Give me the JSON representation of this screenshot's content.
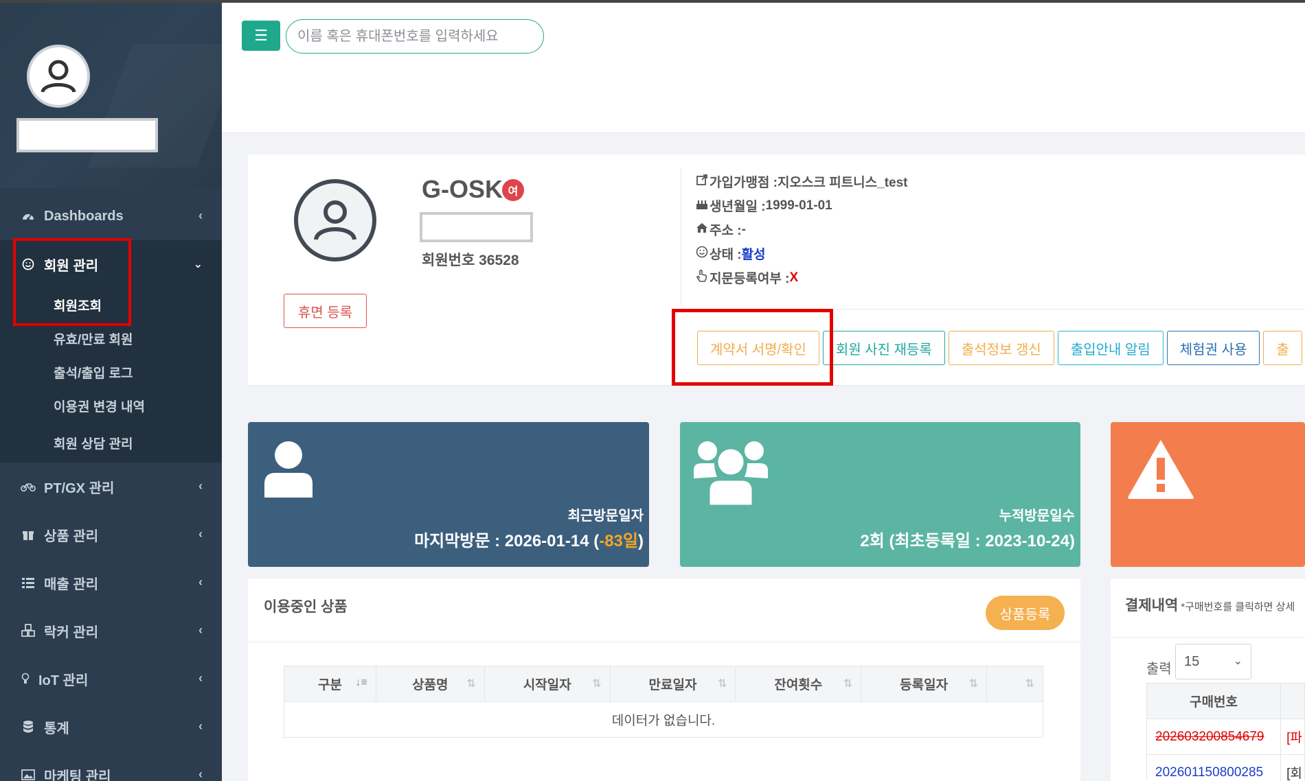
{
  "search": {
    "placeholder": "이름 혹은 휴대폰번호를 입력하세요"
  },
  "sidebar": {
    "nav": [
      {
        "label": "Dashboards",
        "icon": "dashboard-icon"
      },
      {
        "label": "회원 관리",
        "icon": "smile-icon",
        "expanded": true
      },
      {
        "label": "PT/GX 관리",
        "icon": "bicycle-icon"
      },
      {
        "label": "상품 관리",
        "icon": "gift-icon"
      },
      {
        "label": "매출 관리",
        "icon": "list-icon"
      },
      {
        "label": "락커 관리",
        "icon": "cubes-icon"
      },
      {
        "label": "IoT 관리",
        "icon": "lightbulb-icon"
      },
      {
        "label": "통계",
        "icon": "database-icon"
      },
      {
        "label": "마케팅 관리",
        "icon": "image-icon"
      }
    ],
    "sub_items": [
      "회원조회",
      "유효/만료 회원",
      "출석/출입 로그",
      "이용권 변경 내역",
      "회원 상담 관리"
    ]
  },
  "member": {
    "name": "G-OSK",
    "gender": "여",
    "number": "회원번호 36528",
    "dormant_label": "휴면 등록",
    "branch_label": "가입가맹점 : ",
    "branch": "지오스크 피트니스_test",
    "birth_label": "생년월일 : ",
    "birth": "1999-01-01",
    "address_label": "주소 : ",
    "address": "-",
    "status_label": "상태 : ",
    "status": "활성",
    "fingerprint_label": "지문등록여부 : ",
    "fingerprint": "X"
  },
  "actions": [
    "계약서 서명/확인",
    "회원 사진 재등록",
    "출석정보 갱신",
    "출입안내 알림",
    "체험권 사용",
    "출"
  ],
  "cards": {
    "recent_visit_label": "최근방문일자",
    "recent_visit_prefix": "마지막방문 : 2026-01-14 (",
    "recent_visit_days": "-83일",
    "recent_visit_suffix": ")",
    "total_visit_label": "누적방문일수",
    "total_visit_value": "2회 (최초등록일 : 2023-10-24)"
  },
  "products": {
    "title": "이용중인 상품",
    "add_label": "상품등록",
    "columns": [
      "구분",
      "상품명",
      "시작일자",
      "만료일자",
      "잔여횟수",
      "등록일자",
      ""
    ],
    "empty": "데이터가 없습니다."
  },
  "payments": {
    "title": "결제내역",
    "note": "*구매번호를 클릭하면 상세",
    "show_label": "출력",
    "page_size": "15",
    "column": "구매번호",
    "rows": [
      {
        "id": "202603200854679",
        "tag": "[파"
      },
      {
        "id": "202601150800285",
        "tag": "[회"
      }
    ]
  },
  "colors": {
    "sidebar": "#2b3d4f",
    "accent": "#1fa88c",
    "card_blue": "#3d5f7e",
    "card_green": "#5bb5a2",
    "card_orange": "#f47d4e"
  }
}
